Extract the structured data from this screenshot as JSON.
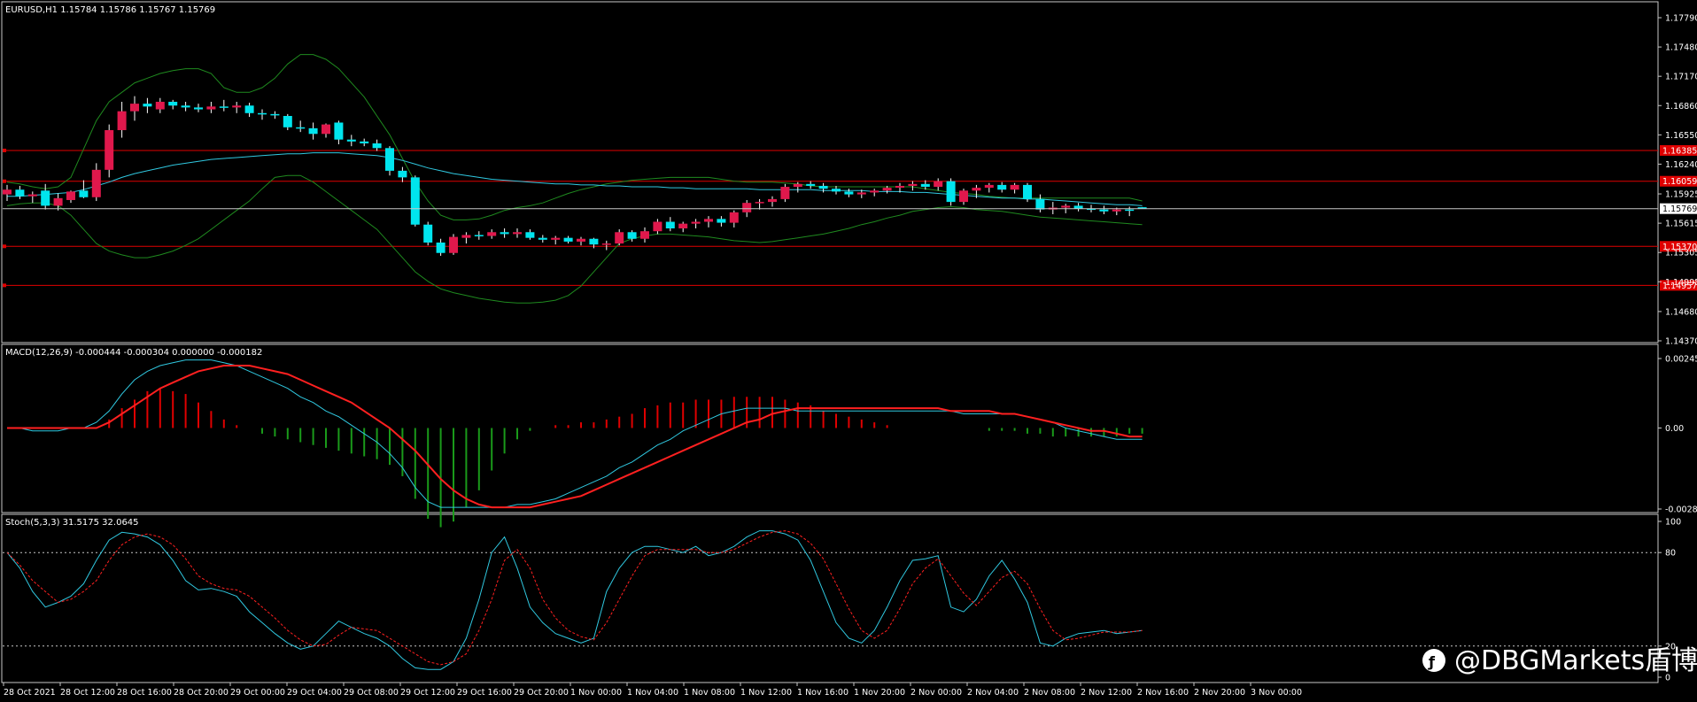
{
  "window": {
    "symbol_header": "EURUSD,H1  1.15784 1.15786 1.15767 1.15769"
  },
  "colors": {
    "background": "#000000",
    "frame": "#c8c8c8",
    "bull_candle": "#e0184c",
    "bear_candle": "#00e5ee",
    "bollinger": "#1f8a1f",
    "moving_average": "#30c8e0",
    "level_line": "#e00000",
    "macd_line": "#30c8e0",
    "signal_line": "#ff2020",
    "hist_positive": "#e00000",
    "hist_negative": "#1a9a1a",
    "stoch_main": "#30c8e0",
    "stoch_signal": "#ff2020",
    "stoch_levels": "#c8c8c8",
    "current_price_box": "#ffffff"
  },
  "price_axis": {
    "ticks": [
      "1.17790",
      "1.17480",
      "1.17170",
      "1.16860",
      "1.16550",
      "1.16240",
      "1.15925",
      "1.15615",
      "1.15305",
      "1.14995",
      "1.14680",
      "1.14370"
    ],
    "current_price": "1.15769"
  },
  "levels": [
    {
      "value": "1.16385"
    },
    {
      "value": "1.16059"
    },
    {
      "value": "1.15370"
    },
    {
      "value": "1.14957"
    }
  ],
  "macd": {
    "header": "MACD(12,26,9) -0.000444 -0.000304 0.000000 -0.000182",
    "ticks": [
      "0.002451",
      "0.00",
      "-0.002858"
    ]
  },
  "stoch": {
    "header": "Stoch(5,3,3) 31.5175 32.0645",
    "ticks": [
      "100",
      "80",
      "20",
      "0"
    ]
  },
  "time_axis": {
    "labels": [
      "28 Oct 2021",
      "28 Oct 12:00",
      "28 Oct 16:00",
      "28 Oct 20:00",
      "29 Oct 00:00",
      "29 Oct 04:00",
      "29 Oct 08:00",
      "29 Oct 12:00",
      "29 Oct 16:00",
      "29 Oct 20:00",
      "1 Nov 00:00",
      "1 Nov 04:00",
      "1 Nov 08:00",
      "1 Nov 12:00",
      "1 Nov 16:00",
      "1 Nov 20:00",
      "2 Nov 00:00",
      "2 Nov 04:00",
      "2 Nov 08:00",
      "2 Nov 12:00",
      "2 Nov 16:00",
      "2 Nov 20:00",
      "3 Nov 00:00"
    ]
  },
  "watermark": {
    "text": "@DBGMarkets盾博"
  },
  "chart_data": {
    "type": "candlestick",
    "timeframe": "H1",
    "ylim": [
      1.1437,
      1.1779
    ],
    "candles": [
      [
        1.1592,
        1.1602,
        1.1585,
        1.1597
      ],
      [
        1.1597,
        1.1601,
        1.1587,
        1.159
      ],
      [
        1.159,
        1.1595,
        1.1583,
        1.1592
      ],
      [
        1.1596,
        1.1603,
        1.1576,
        1.158
      ],
      [
        1.158,
        1.1593,
        1.1575,
        1.1588
      ],
      [
        1.1586,
        1.1596,
        1.1583,
        1.1595
      ],
      [
        1.1596,
        1.1607,
        1.1588,
        1.1589
      ],
      [
        1.1589,
        1.1625,
        1.1585,
        1.1618
      ],
      [
        1.1618,
        1.1666,
        1.161,
        1.166
      ],
      [
        1.166,
        1.169,
        1.1652,
        1.168
      ],
      [
        1.168,
        1.1696,
        1.167,
        1.1688
      ],
      [
        1.1688,
        1.1694,
        1.1678,
        1.1685
      ],
      [
        1.1682,
        1.1694,
        1.1678,
        1.169
      ],
      [
        1.169,
        1.1692,
        1.1682,
        1.1686
      ],
      [
        1.1686,
        1.169,
        1.168,
        1.1684
      ],
      [
        1.1684,
        1.1688,
        1.1679,
        1.1682
      ],
      [
        1.1682,
        1.169,
        1.1678,
        1.1685
      ],
      [
        1.1685,
        1.1692,
        1.168,
        1.1684
      ],
      [
        1.1684,
        1.169,
        1.1678,
        1.1686
      ],
      [
        1.1686,
        1.1689,
        1.1674,
        1.1678
      ],
      [
        1.1678,
        1.1682,
        1.1671,
        1.1677
      ],
      [
        1.1677,
        1.168,
        1.1672,
        1.1676
      ],
      [
        1.1675,
        1.1677,
        1.166,
        1.1663
      ],
      [
        1.1663,
        1.167,
        1.1658,
        1.1662
      ],
      [
        1.1662,
        1.1668,
        1.165,
        1.1656
      ],
      [
        1.1656,
        1.1667,
        1.1652,
        1.1666
      ],
      [
        1.1668,
        1.167,
        1.1645,
        1.165
      ],
      [
        1.165,
        1.1655,
        1.1643,
        1.1648
      ],
      [
        1.1648,
        1.1651,
        1.1643,
        1.1646
      ],
      [
        1.1646,
        1.165,
        1.1638,
        1.1641
      ],
      [
        1.1641,
        1.1643,
        1.1612,
        1.1617
      ],
      [
        1.1617,
        1.1621,
        1.1605,
        1.161
      ],
      [
        1.161,
        1.1612,
        1.1558,
        1.156
      ],
      [
        1.156,
        1.1563,
        1.1538,
        1.1541
      ],
      [
        1.1541,
        1.1545,
        1.1527,
        1.153
      ],
      [
        1.153,
        1.155,
        1.1528,
        1.1547
      ],
      [
        1.1546,
        1.1552,
        1.154,
        1.1549
      ],
      [
        1.1549,
        1.1553,
        1.1544,
        1.1548
      ],
      [
        1.1548,
        1.1555,
        1.1545,
        1.1552
      ],
      [
        1.1552,
        1.1556,
        1.1546,
        1.155
      ],
      [
        1.155,
        1.1556,
        1.1546,
        1.1552
      ],
      [
        1.1552,
        1.1555,
        1.1544,
        1.1546
      ],
      [
        1.1546,
        1.1549,
        1.1541,
        1.1544
      ],
      [
        1.1544,
        1.1548,
        1.1539,
        1.1546
      ],
      [
        1.1546,
        1.1548,
        1.154,
        1.1542
      ],
      [
        1.1542,
        1.1547,
        1.1538,
        1.1545
      ],
      [
        1.1545,
        1.1546,
        1.1535,
        1.1539
      ],
      [
        1.1539,
        1.1543,
        1.1533,
        1.154
      ],
      [
        1.154,
        1.1555,
        1.1538,
        1.1552
      ],
      [
        1.1552,
        1.1554,
        1.1542,
        1.1545
      ],
      [
        1.1545,
        1.1557,
        1.1541,
        1.1553
      ],
      [
        1.1553,
        1.1566,
        1.155,
        1.1563
      ],
      [
        1.1563,
        1.1568,
        1.1553,
        1.1556
      ],
      [
        1.1556,
        1.1563,
        1.1552,
        1.1561
      ],
      [
        1.1561,
        1.1566,
        1.1556,
        1.1563
      ],
      [
        1.1563,
        1.1569,
        1.1557,
        1.1566
      ],
      [
        1.1566,
        1.1569,
        1.1558,
        1.1562
      ],
      [
        1.1562,
        1.1575,
        1.1557,
        1.1573
      ],
      [
        1.1573,
        1.1586,
        1.1568,
        1.1583
      ],
      [
        1.1583,
        1.1587,
        1.1576,
        1.1584
      ],
      [
        1.1584,
        1.159,
        1.1579,
        1.1587
      ],
      [
        1.1587,
        1.1603,
        1.1584,
        1.16
      ],
      [
        1.16,
        1.1605,
        1.1594,
        1.1603
      ],
      [
        1.1603,
        1.1606,
        1.1598,
        1.1601
      ],
      [
        1.1601,
        1.1604,
        1.1594,
        1.1598
      ],
      [
        1.1598,
        1.1601,
        1.1592,
        1.1595
      ],
      [
        1.1595,
        1.1598,
        1.1589,
        1.1592
      ],
      [
        1.1592,
        1.1597,
        1.1588,
        1.1594
      ],
      [
        1.1594,
        1.1598,
        1.159,
        1.1596
      ],
      [
        1.1596,
        1.1601,
        1.1593,
        1.1599
      ],
      [
        1.1599,
        1.1604,
        1.1594,
        1.1601
      ],
      [
        1.1601,
        1.1606,
        1.1596,
        1.1603
      ],
      [
        1.1603,
        1.1607,
        1.1597,
        1.16
      ],
      [
        1.16,
        1.1609,
        1.1596,
        1.1606
      ],
      [
        1.1606,
        1.1609,
        1.158,
        1.1584
      ],
      [
        1.1584,
        1.1598,
        1.1581,
        1.1596
      ],
      [
        1.1596,
        1.1602,
        1.1588,
        1.1599
      ],
      [
        1.1599,
        1.1604,
        1.1594,
        1.1602
      ],
      [
        1.1602,
        1.1605,
        1.1594,
        1.1597
      ],
      [
        1.1597,
        1.1604,
        1.1593,
        1.1602
      ],
      [
        1.1602,
        1.1604,
        1.1584,
        1.1587
      ],
      [
        1.1587,
        1.1592,
        1.1573,
        1.1576
      ],
      [
        1.1576,
        1.1584,
        1.1571,
        1.1578
      ],
      [
        1.1578,
        1.1582,
        1.1572,
        1.158
      ],
      [
        1.158,
        1.1583,
        1.1574,
        1.1577
      ],
      [
        1.1577,
        1.1581,
        1.1573,
        1.1576
      ],
      [
        1.1576,
        1.158,
        1.1571,
        1.1574
      ],
      [
        1.1574,
        1.1578,
        1.157,
        1.1576
      ],
      [
        1.1576,
        1.1579,
        1.1569,
        1.1575
      ],
      [
        1.15784,
        1.15786,
        1.15767,
        1.15769
      ]
    ],
    "macd_histogram": [
      0.0,
      0.0,
      0.0,
      0.0,
      0.0,
      0.0,
      0.0,
      0.0,
      0.0003,
      0.0007,
      0.001,
      0.0013,
      0.0014,
      0.0013,
      0.0012,
      0.0009,
      0.0006,
      0.0003,
      0.0001,
      0.0,
      -0.0002,
      -0.0003,
      -0.0004,
      -0.0005,
      -0.0006,
      -0.0007,
      -0.0008,
      -0.0009,
      -0.001,
      -0.0011,
      -0.0013,
      -0.0017,
      -0.0025,
      -0.0032,
      -0.0035,
      -0.0033,
      -0.0028,
      -0.0022,
      -0.0015,
      -0.0009,
      -0.0004,
      -0.0001,
      0.0,
      0.0001,
      0.0001,
      0.0002,
      0.0002,
      0.0003,
      0.0004,
      0.0005,
      0.0007,
      0.0008,
      0.0009,
      0.0009,
      0.001,
      0.001,
      0.001,
      0.0011,
      0.0011,
      0.0011,
      0.0011,
      0.001,
      0.0009,
      0.0008,
      0.0006,
      0.0005,
      0.0004,
      0.0003,
      0.0002,
      0.0001,
      0.0,
      0.0,
      0.0,
      0.0,
      0.0,
      0.0,
      0.0,
      -0.0001,
      -0.0001,
      -0.0001,
      -0.0002,
      -0.0002,
      -0.0003,
      -0.0003,
      -0.0003,
      -0.0003,
      -0.0003,
      -0.0003,
      -0.0002,
      -0.0002
    ],
    "macd_main": [
      0.0,
      0.0,
      -0.0001,
      -0.0001,
      -0.0001,
      0.0,
      0.0,
      0.0002,
      0.0006,
      0.0012,
      0.0017,
      0.002,
      0.0022,
      0.0023,
      0.0024,
      0.0024,
      0.0024,
      0.0023,
      0.0022,
      0.002,
      0.0018,
      0.0016,
      0.0014,
      0.0011,
      0.0009,
      0.0006,
      0.0004,
      0.0001,
      -0.0002,
      -0.0005,
      -0.0009,
      -0.0014,
      -0.0021,
      -0.0026,
      -0.0028,
      -0.0028,
      -0.0028,
      -0.0028,
      -0.0028,
      -0.0028,
      -0.0027,
      -0.0027,
      -0.0026,
      -0.0025,
      -0.0023,
      -0.0021,
      -0.0019,
      -0.0017,
      -0.0014,
      -0.0012,
      -0.0009,
      -0.0006,
      -0.0004,
      -0.0001,
      0.0001,
      0.0003,
      0.0005,
      0.0006,
      0.0007,
      0.0007,
      0.0007,
      0.0007,
      0.0006,
      0.0006,
      0.0006,
      0.0006,
      0.0006,
      0.0006,
      0.0006,
      0.0006,
      0.0006,
      0.0006,
      0.0006,
      0.0006,
      0.0006,
      0.0005,
      0.0005,
      0.0005,
      0.0005,
      0.0005,
      0.0004,
      0.0003,
      0.0002,
      0.0,
      -0.0001,
      -0.0002,
      -0.0003,
      -0.0004,
      -0.0004,
      -0.0004
    ],
    "macd_signal": [
      0.0,
      0.0,
      0.0,
      0.0,
      0.0,
      0.0,
      0.0,
      0.0,
      0.0002,
      0.0005,
      0.0008,
      0.0011,
      0.0014,
      0.0016,
      0.0018,
      0.002,
      0.0021,
      0.0022,
      0.0022,
      0.0022,
      0.0021,
      0.002,
      0.0019,
      0.0017,
      0.0015,
      0.0013,
      0.0011,
      0.0009,
      0.0006,
      0.0003,
      0.0,
      -0.0004,
      -0.0008,
      -0.0013,
      -0.0018,
      -0.0022,
      -0.0025,
      -0.0027,
      -0.0028,
      -0.0028,
      -0.0028,
      -0.0028,
      -0.0027,
      -0.0026,
      -0.0025,
      -0.0024,
      -0.0022,
      -0.002,
      -0.0018,
      -0.0016,
      -0.0014,
      -0.0012,
      -0.001,
      -0.0008,
      -0.0006,
      -0.0004,
      -0.0002,
      0.0,
      0.0002,
      0.0003,
      0.0005,
      0.0006,
      0.0007,
      0.0007,
      0.0007,
      0.0007,
      0.0007,
      0.0007,
      0.0007,
      0.0007,
      0.0007,
      0.0007,
      0.0007,
      0.0007,
      0.0006,
      0.0006,
      0.0006,
      0.0006,
      0.0005,
      0.0005,
      0.0004,
      0.0003,
      0.0002,
      0.0001,
      0.0,
      -0.0001,
      -0.0001,
      -0.0002,
      -0.0003,
      -0.0003
    ],
    "stoch_main": [
      80,
      70,
      55,
      45,
      48,
      52,
      60,
      75,
      88,
      93,
      92,
      90,
      85,
      75,
      62,
      56,
      57,
      55,
      52,
      42,
      35,
      28,
      22,
      18,
      20,
      28,
      36,
      32,
      28,
      25,
      20,
      12,
      6,
      5,
      5,
      10,
      25,
      50,
      80,
      90,
      70,
      45,
      35,
      28,
      25,
      22,
      25,
      55,
      70,
      80,
      84,
      84,
      82,
      80,
      84,
      78,
      80,
      84,
      90,
      94,
      94,
      92,
      88,
      75,
      55,
      35,
      25,
      22,
      30,
      45,
      62,
      75,
      76,
      78,
      45,
      42,
      50,
      65,
      75,
      63,
      48,
      22,
      20,
      25,
      28,
      29,
      30,
      28,
      29,
      30
    ],
    "stoch_signal": [
      80,
      72,
      62,
      55,
      48,
      50,
      55,
      62,
      75,
      85,
      90,
      92,
      90,
      85,
      76,
      65,
      60,
      57,
      56,
      52,
      45,
      38,
      30,
      24,
      20,
      21,
      27,
      32,
      31,
      30,
      25,
      20,
      15,
      10,
      8,
      10,
      15,
      30,
      50,
      75,
      82,
      70,
      50,
      38,
      30,
      26,
      24,
      35,
      50,
      65,
      78,
      82,
      82,
      82,
      82,
      80,
      80,
      82,
      86,
      90,
      93,
      94,
      92,
      86,
      76,
      60,
      44,
      30,
      25,
      30,
      44,
      60,
      70,
      76,
      65,
      54,
      46,
      55,
      64,
      68,
      60,
      44,
      30,
      24,
      25,
      27,
      29,
      29,
      29,
      30
    ],
    "bb_upper": [
      1.1605,
      1.1603,
      1.16,
      1.1598,
      1.16,
      1.161,
      1.164,
      1.167,
      1.169,
      1.17,
      1.171,
      1.1715,
      1.172,
      1.1723,
      1.1725,
      1.1725,
      1.172,
      1.1705,
      1.17,
      1.17,
      1.1705,
      1.1715,
      1.173,
      1.174,
      1.174,
      1.1735,
      1.1725,
      1.171,
      1.1695,
      1.1675,
      1.1655,
      1.163,
      1.1605,
      1.1585,
      1.157,
      1.1565,
      1.1565,
      1.1566,
      1.157,
      1.1575,
      1.1578,
      1.158,
      1.1583,
      1.1588,
      1.1593,
      1.1597,
      1.16,
      1.1603,
      1.1605,
      1.1607,
      1.1608,
      1.1609,
      1.161,
      1.161,
      1.161,
      1.161,
      1.1608,
      1.1606,
      1.1605,
      1.1605,
      1.1605,
      1.1604,
      1.1603,
      1.1601,
      1.16,
      1.16,
      1.16,
      1.16,
      1.16,
      1.16,
      1.16,
      1.16,
      1.1598,
      1.1596,
      1.1594,
      1.1593,
      1.1592,
      1.159,
      1.1589,
      1.1588,
      1.1588,
      1.1588,
      1.1588,
      1.1588,
      1.1588,
      1.1588,
      1.1588,
      1.1588,
      1.1588,
      1.1585
    ],
    "bb_mid": [
      1.159,
      1.159,
      1.1591,
      1.1592,
      1.1593,
      1.1594,
      1.1597,
      1.1601,
      1.1605,
      1.161,
      1.1614,
      1.1617,
      1.162,
      1.1623,
      1.1625,
      1.1627,
      1.1629,
      1.163,
      1.1631,
      1.1632,
      1.1633,
      1.1634,
      1.1635,
      1.1635,
      1.1636,
      1.1636,
      1.1636,
      1.1635,
      1.1634,
      1.1633,
      1.1631,
      1.1628,
      1.1624,
      1.162,
      1.1617,
      1.1614,
      1.1612,
      1.161,
      1.1608,
      1.1607,
      1.1606,
      1.1605,
      1.1604,
      1.1603,
      1.1603,
      1.1602,
      1.1602,
      1.1601,
      1.1601,
      1.16,
      1.16,
      1.16,
      1.1599,
      1.1599,
      1.1598,
      1.1598,
      1.1598,
      1.1598,
      1.1598,
      1.1597,
      1.1597,
      1.1597,
      1.1597,
      1.1597,
      1.1596,
      1.1596,
      1.1596,
      1.1596,
      1.1595,
      1.1595,
      1.1595,
      1.1594,
      1.1594,
      1.1593,
      1.1592,
      1.1591,
      1.159,
      1.1589,
      1.1588,
      1.1588,
      1.1587,
      1.1587,
      1.1586,
      1.1585,
      1.1584,
      1.1583,
      1.1582,
      1.1581,
      1.1581,
      1.158
    ],
    "bb_lower": [
      1.158,
      1.1582,
      1.1583,
      1.1583,
      1.158,
      1.157,
      1.1555,
      1.154,
      1.1532,
      1.1528,
      1.1525,
      1.1525,
      1.1528,
      1.1532,
      1.1538,
      1.1545,
      1.1555,
      1.1565,
      1.1575,
      1.1585,
      1.1598,
      1.161,
      1.1612,
      1.1612,
      1.1605,
      1.1595,
      1.1585,
      1.1575,
      1.1565,
      1.1555,
      1.154,
      1.1525,
      1.151,
      1.15,
      1.1492,
      1.1488,
      1.1485,
      1.1482,
      1.148,
      1.1478,
      1.1477,
      1.1477,
      1.1478,
      1.148,
      1.1485,
      1.1495,
      1.151,
      1.1525,
      1.154,
      1.1545,
      1.1548,
      1.155,
      1.155,
      1.1549,
      1.1548,
      1.1547,
      1.1545,
      1.1543,
      1.1542,
      1.1541,
      1.1542,
      1.1544,
      1.1546,
      1.1548,
      1.155,
      1.1553,
      1.1556,
      1.156,
      1.1563,
      1.1567,
      1.157,
      1.1574,
      1.1576,
      1.1578,
      1.1579,
      1.1578,
      1.1576,
      1.1575,
      1.1574,
      1.1572,
      1.157,
      1.1568,
      1.1567,
      1.1566,
      1.1565,
      1.1564,
      1.1563,
      1.1562,
      1.1561,
      1.156
    ]
  }
}
